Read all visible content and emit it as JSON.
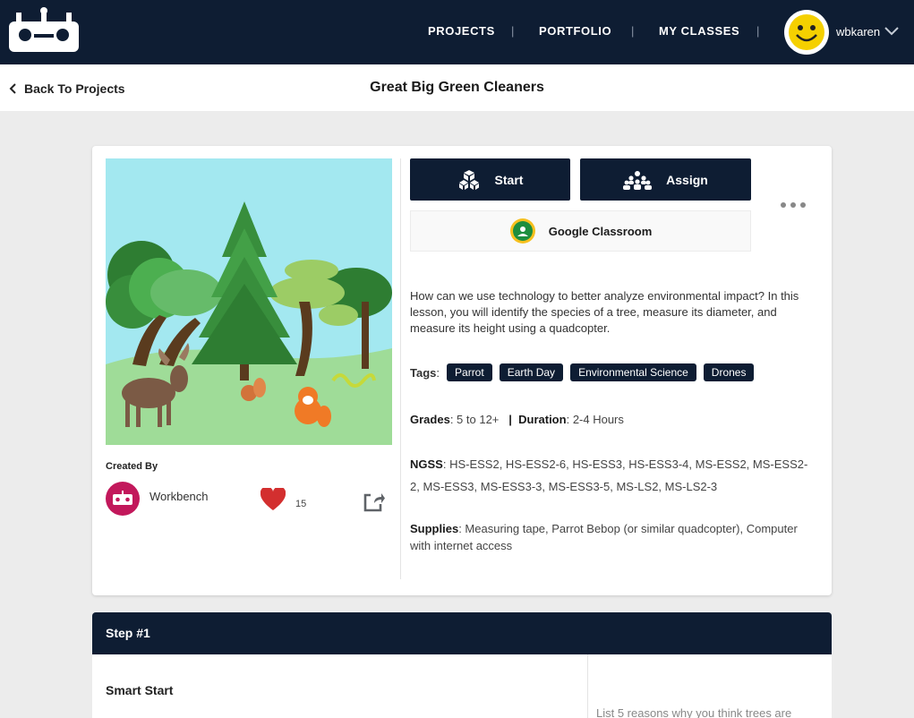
{
  "nav": {
    "items": [
      "PROJECTS",
      "PORTFOLIO",
      "MY CLASSES"
    ],
    "separator": "|",
    "username": "wbkaren"
  },
  "subheader": {
    "back_label": "Back To Projects",
    "title": "Great Big Green Cleaners"
  },
  "project": {
    "start_label": "Start",
    "assign_label": "Assign",
    "google_classroom_label": "Google Classroom",
    "description": "How can we use technology to better analyze environmental impact? In this lesson, you will identify the species of a tree, measure its diameter, and measure its height using a quadcopter.",
    "tags_label": "Tags",
    "tags": [
      "Parrot",
      "Earth Day",
      "Environmental Science",
      "Drones"
    ],
    "grades_label": "Grades",
    "grades": "5 to 12+",
    "duration_label": "Duration",
    "duration": "2-4 Hours",
    "ngss_label": "NGSS",
    "ngss": "HS-ESS2, HS-ESS2-6, HS-ESS3, HS-ESS3-4, MS-ESS2, MS-ESS2-2, MS-ESS3, MS-ESS3-3, MS-ESS3-5, MS-LS2, MS-LS2-3",
    "supplies_label": "Supplies",
    "supplies": "Measuring tape, Parrot Bebop (or similar quadcopter), Computer with internet access",
    "created_by_label": "Created By",
    "creator": "Workbench",
    "likes": "15"
  },
  "step": {
    "header": "Step #1",
    "title": "Smart Start",
    "prompt": "List 5 reasons why you think trees are"
  },
  "colors": {
    "navy": "#0e1d33",
    "creator_badge": "#c2185b",
    "heart": "#d32f2f",
    "google_green": "#1e8e3e"
  }
}
